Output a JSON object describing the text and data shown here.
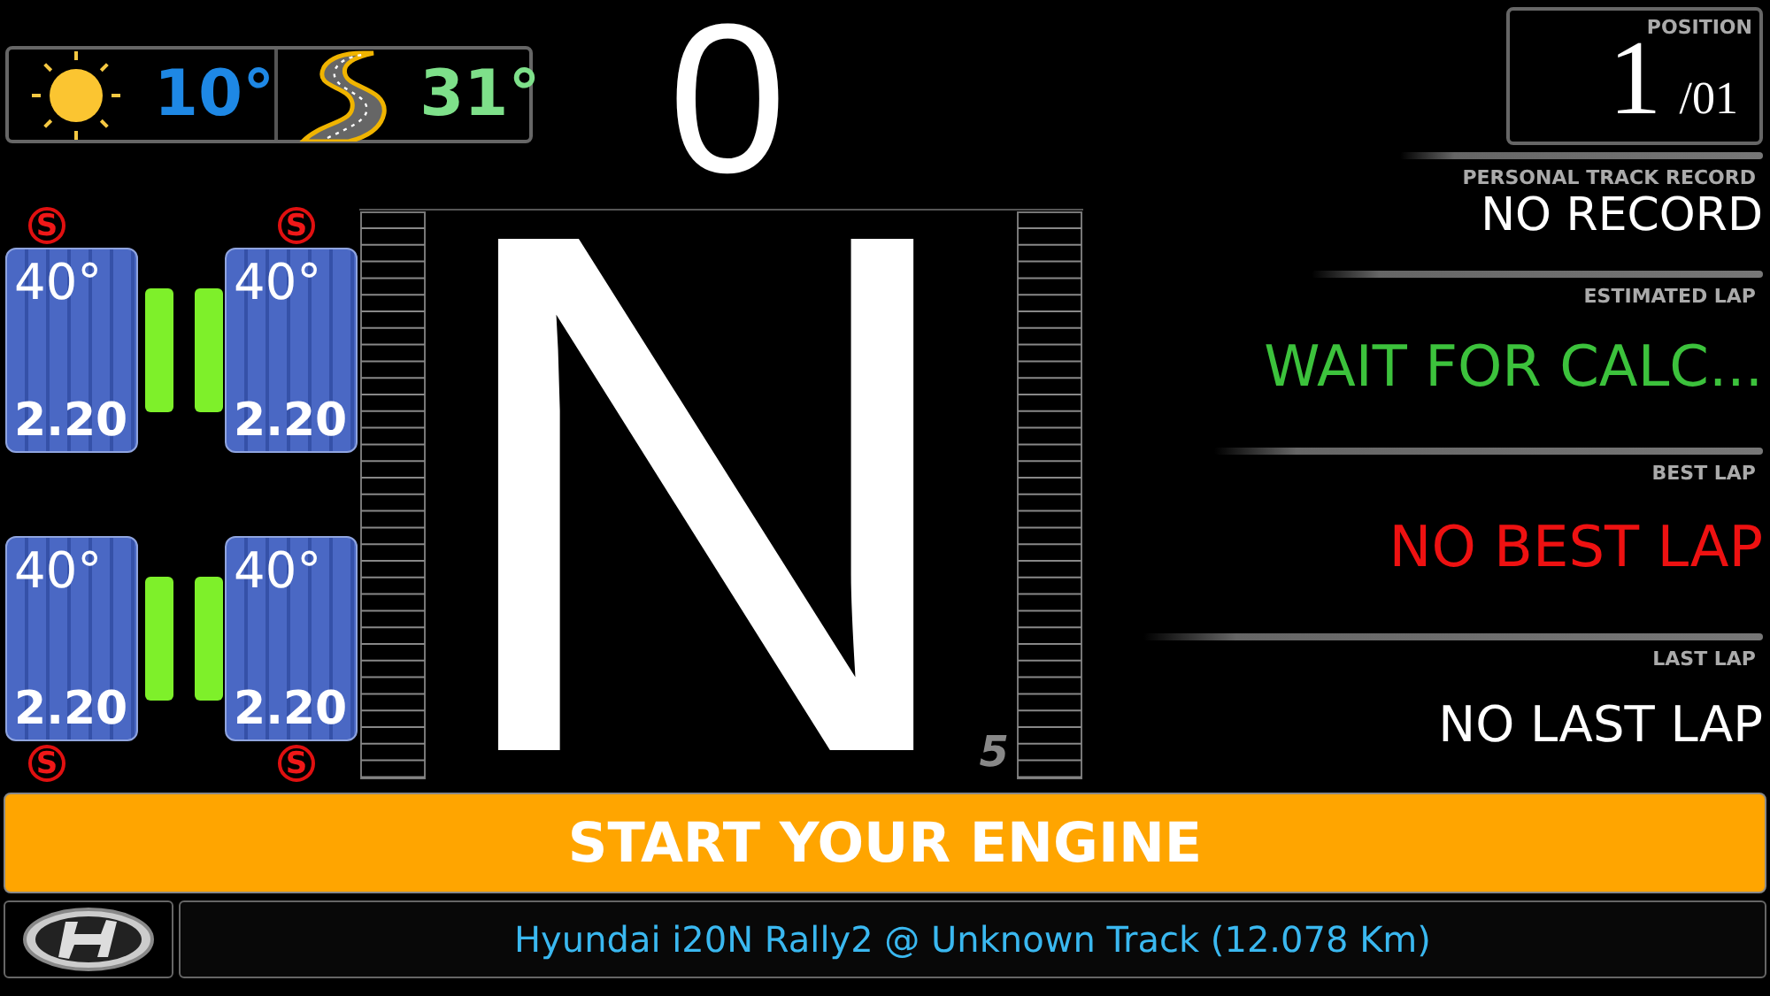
{
  "weather": {
    "air_temp": "10°",
    "track_temp": "31°"
  },
  "speed": "0",
  "axles": [
    {
      "tires": [
        {
          "temp": "40°",
          "pressure": "2.20",
          "compound": "S"
        },
        {
          "temp": "40°",
          "pressure": "2.20",
          "compound": "S"
        }
      ]
    },
    {
      "tires": [
        {
          "temp": "40°",
          "pressure": "2.20",
          "compound": "S"
        },
        {
          "temp": "40°",
          "pressure": "2.20",
          "compound": "S"
        }
      ]
    }
  ],
  "gear": {
    "current": "N",
    "hint": "5"
  },
  "position": {
    "label": "POSITION",
    "value": "1",
    "total": "/01"
  },
  "laps": [
    {
      "label": "PERSONAL TRACK RECORD",
      "value": "NO RECORD",
      "color": "#ffffff"
    },
    {
      "label": "ESTIMATED LAP",
      "value": "WAIT FOR CALC...",
      "color": "#3cc23c"
    },
    {
      "label": "BEST LAP",
      "value": "NO BEST LAP",
      "color": "#ee1111"
    },
    {
      "label": "LAST LAP",
      "value": "NO LAST LAP",
      "color": "#ffffff"
    }
  ],
  "banner": "START YOUR ENGINE",
  "footer": {
    "info": "Hyundai i20N Rally2 @ Unknown Track (12.078 Km)"
  }
}
